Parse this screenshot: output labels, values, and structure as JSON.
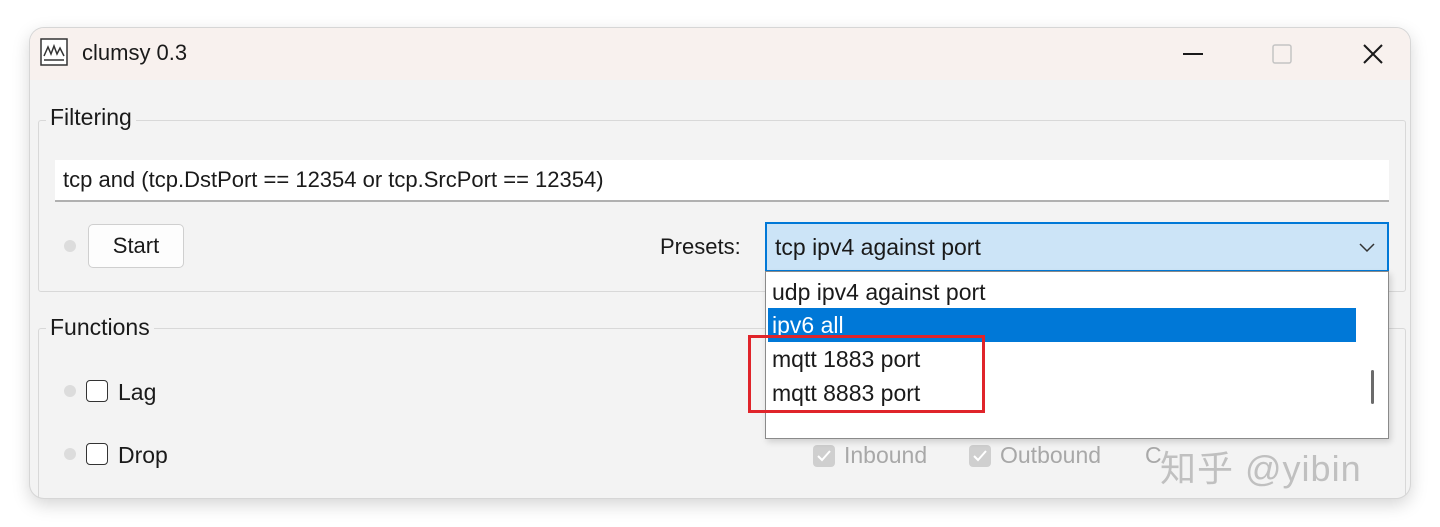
{
  "window": {
    "title": "clumsy 0.3",
    "icon": "waveform-app-icon",
    "controls": [
      "minimize-icon",
      "maximize-icon",
      "close-icon"
    ]
  },
  "filtering": {
    "group_label": "Filtering",
    "filter_text": "tcp and (tcp.DstPort == 12354 or tcp.SrcPort == 12354)",
    "start_label": "Start",
    "presets_label": "Presets:",
    "preset_selected": "tcp ipv4 against port",
    "preset_options_visible": [
      "udp ipv4 against port",
      "ipv6 all",
      "mqtt 1883 port",
      "mqtt 8883 port"
    ],
    "highlighted_option": "ipv6 all"
  },
  "functions": {
    "group_label": "Functions",
    "items": [
      {
        "label": "Lag",
        "checked": false
      },
      {
        "label": "Drop",
        "checked": false
      }
    ],
    "drop_options": {
      "inbound": "Inbound",
      "outbound": "Outbound",
      "chance_partial": "C"
    }
  },
  "watermark": "知乎 @yibin",
  "colors": {
    "accent": "#0078d7",
    "combo_bg": "#cce4f7",
    "highlight_annotation": "#e0242a",
    "titlebar": "#f8f1ee"
  }
}
